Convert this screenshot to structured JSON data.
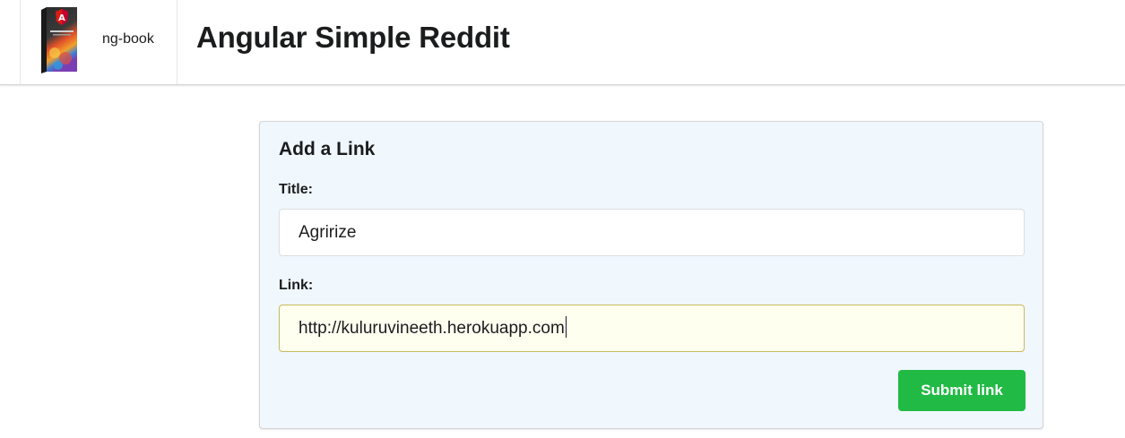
{
  "menu": {
    "brand_name": "ng-book",
    "brand_icon": "ng-book-cover-icon",
    "app_title": "Angular Simple Reddit"
  },
  "form": {
    "header": "Add a Link",
    "title_label": "Title:",
    "title_value": "Agririze",
    "link_label": "Link:",
    "link_value": "http://kuluruvineeth.herokuapp.com",
    "submit_label": "Submit link"
  },
  "colors": {
    "submit_green": "#21ba45",
    "card_background": "#f0f7fd",
    "focused_input_background": "#fffff0",
    "angular_red": "#dd1b16"
  }
}
